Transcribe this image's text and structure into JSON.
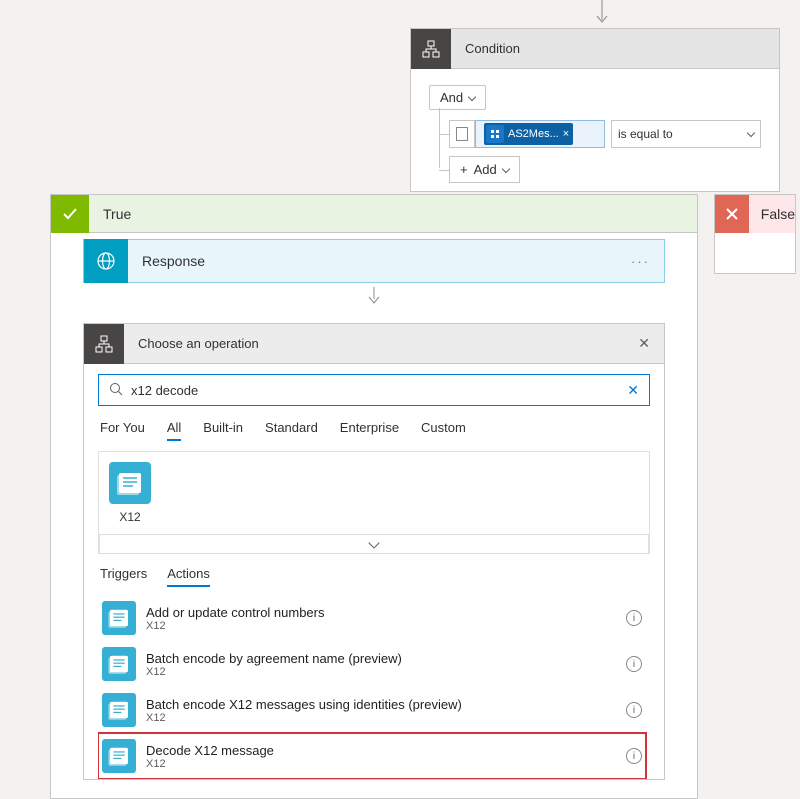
{
  "condition": {
    "title": "Condition",
    "groupOperator": "And",
    "row": {
      "token": "AS2Mes...",
      "comparator": "is equal to"
    },
    "addLabel": "Add"
  },
  "trueBranch": {
    "label": "True"
  },
  "falseBranch": {
    "label": "False"
  },
  "response": {
    "title": "Response"
  },
  "chooseOp": {
    "title": "Choose an operation",
    "searchValue": "x12 decode",
    "filterTabs": [
      "For You",
      "All",
      "Built-in",
      "Standard",
      "Enterprise",
      "Custom"
    ],
    "activeFilter": "All",
    "connector": {
      "name": "X12"
    },
    "taTabs": [
      "Triggers",
      "Actions"
    ],
    "activeTa": "Actions",
    "actions": [
      {
        "title": "Add or update control numbers",
        "subtitle": "X12"
      },
      {
        "title": "Batch encode by agreement name (preview)",
        "subtitle": "X12"
      },
      {
        "title": "Batch encode X12 messages using identities (preview)",
        "subtitle": "X12"
      },
      {
        "title": "Decode X12 message",
        "subtitle": "X12",
        "highlight": true
      }
    ]
  }
}
